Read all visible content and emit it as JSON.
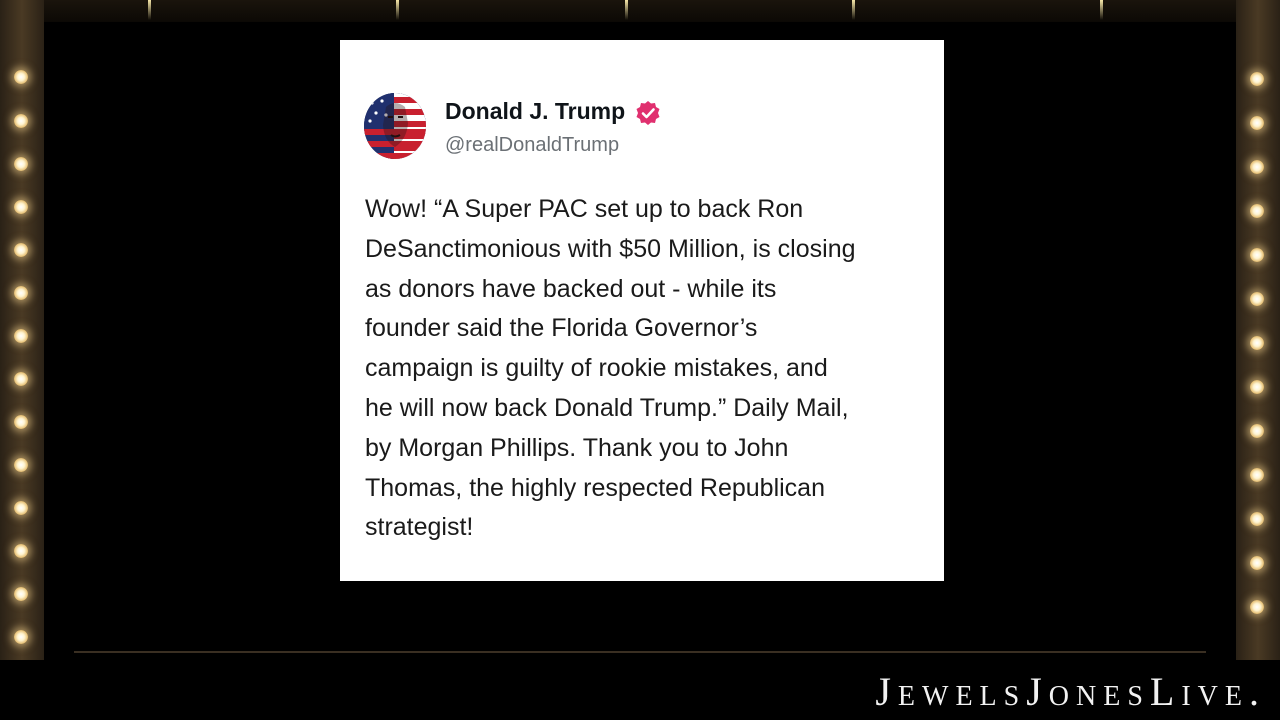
{
  "post": {
    "author_name": "Donald J. Trump",
    "author_handle": "@realDonaldTrump",
    "verified_color": "#e0306f",
    "text_lines": [
      "Wow! “A Super PAC set up to back Ron",
      "DeSanctimonious with $50 Million, is closing",
      "as donors have backed out - while its",
      "founder said the Florida Governor’s",
      "campaign is guilty of rookie mistakes, and",
      "he will now back Donald Trump.” Daily Mail,",
      "by Morgan Phillips. Thank you to John",
      "Thomas, the highly respected Republican",
      "strategist!"
    ]
  },
  "watermark": {
    "text": "JewelsJonesLive."
  },
  "icons": {
    "avatar": "flag-portrait-avatar",
    "verified": "verified-badge-icon"
  },
  "colors": {
    "background": "#000000",
    "card": "#ffffff",
    "frame": "#3a2d1c",
    "bulb": "#fff4d0"
  }
}
